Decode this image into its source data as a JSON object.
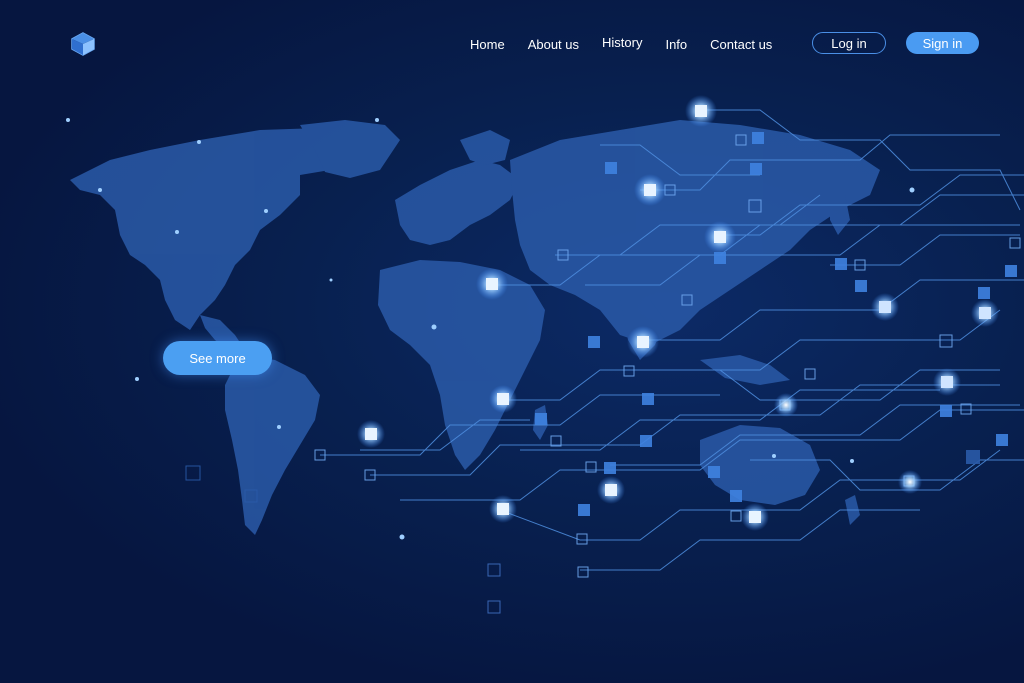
{
  "nav": {
    "home": "Home",
    "about": "About us",
    "history": "History",
    "info": "Info",
    "contact": "Contact us"
  },
  "auth": {
    "login": "Log in",
    "signin": "Sign in"
  },
  "hero": {
    "cta": "See more"
  },
  "colors": {
    "background": "#061640",
    "map": "#2a5aa8",
    "circuit": "#4f8fe0",
    "accent_button": "#4a9bf2",
    "glow": "#cfe4ff"
  },
  "icons": {
    "logo": "hexagon-cube-logo-icon"
  }
}
